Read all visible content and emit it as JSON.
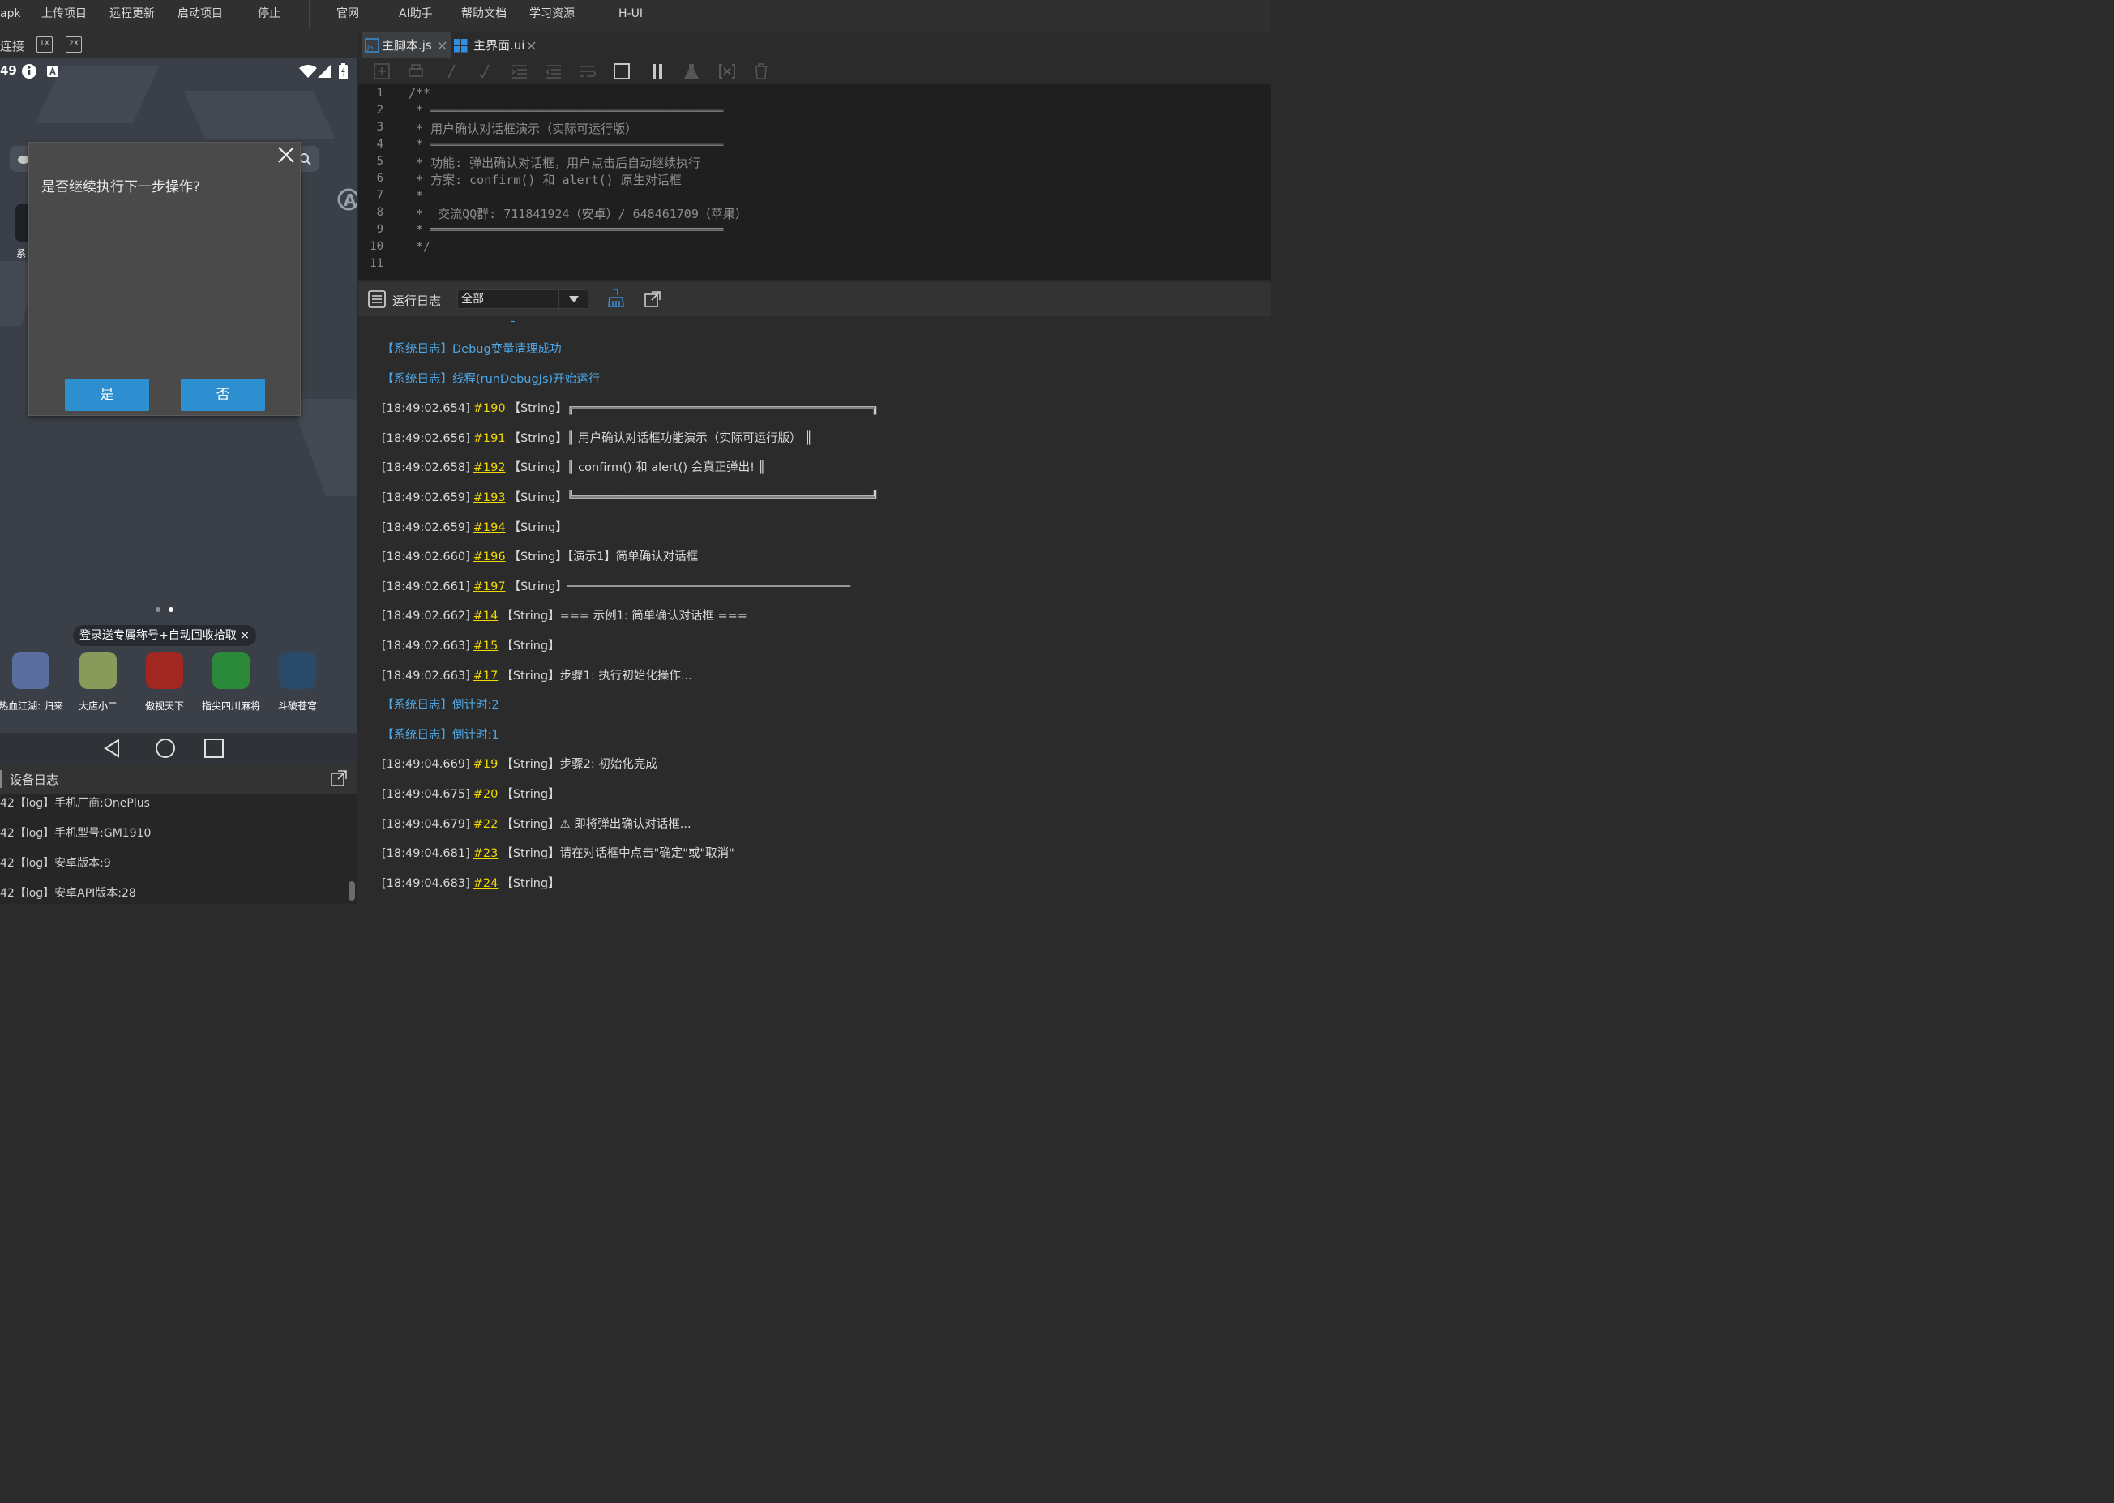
{
  "menu": {
    "items": [
      "apk",
      "上传项目",
      "远程更新",
      "启动项目",
      "停止",
      "官网",
      "AI助手",
      "帮助文档",
      "学习资源",
      "H-UI"
    ]
  },
  "device": {
    "connect_label": "连接",
    "scale_1x": "1X",
    "scale_2x": "2X",
    "status_time": "49",
    "dialog": {
      "message": "是否继续执行下一步操作?",
      "yes_label": "是",
      "no_label": "否"
    },
    "side_app_label": "系",
    "promo_text": "登录送专属称号+自动回收拾取",
    "promo_close": "×",
    "apps": [
      {
        "label": "热血江湖: 归来",
        "color": "#5a6fa0"
      },
      {
        "label": "大店小二",
        "color": "#8a9a5a"
      },
      {
        "label": "傲视天下",
        "color": "#a02820"
      },
      {
        "label": "指尖四川麻将",
        "color": "#2a8a3a"
      },
      {
        "label": "斗破苍穹",
        "color": "#2a4a6a"
      }
    ]
  },
  "device_log": {
    "title": "设备日志",
    "rows": [
      "42【log】手机厂商:OnePlus",
      "42【log】手机型号:GM1910",
      "42【log】安卓版本:9",
      "42【log】安卓API版本:28"
    ]
  },
  "editor": {
    "tabs": [
      {
        "label": "主脚本.js",
        "icon": "js-file-icon"
      },
      {
        "label": "主界面.ui",
        "icon": "ui-file-icon"
      }
    ],
    "line_numbers": [
      "1",
      "2",
      "3",
      "4",
      "5",
      "6",
      "7",
      "8",
      "9",
      "10",
      "11"
    ],
    "code_lines": [
      "/**",
      " * ════════════════════════════════════════",
      " * 用户确认对话框演示（实际可运行版）",
      " * ════════════════════════════════════════",
      " * 功能: 弹出确认对话框，用户点击后自动继续执行",
      " * 方案: confirm() 和 alert() 原生对话框",
      " *",
      " *  交流QQ群: 711841924（安卓）/ 648461709（苹果）",
      " * ════════════════════════════════════════",
      " */",
      ""
    ]
  },
  "run_log": {
    "title": "运行日志",
    "filter_value": "全部",
    "rows": [
      {
        "type": "sys",
        "text": "【系统日志】Debug变量清理成功"
      },
      {
        "type": "sys",
        "text": "【系统日志】线程(runDebugJs)开始运行"
      },
      {
        "type": "log",
        "ts": "[18:49:02.654]",
        "id": "#190",
        "text": "【String】╔══════════════════════════════════════════╗"
      },
      {
        "type": "log",
        "ts": "[18:49:02.656]",
        "id": "#191",
        "text": "【String】║   用户确认对话框功能演示（实际可运行版）    ║"
      },
      {
        "type": "log",
        "ts": "[18:49:02.658]",
        "id": "#192",
        "text": "【String】║   confirm() 和 alert() 会真正弹出!          ║"
      },
      {
        "type": "log",
        "ts": "[18:49:02.659]",
        "id": "#193",
        "text": "【String】╚══════════════════════════════════════════╝"
      },
      {
        "type": "log",
        "ts": "[18:49:02.659]",
        "id": "#194",
        "text": "【String】"
      },
      {
        "type": "log",
        "ts": "[18:49:02.660]",
        "id": "#196",
        "text": "【String】【演示1】简单确认对话框"
      },
      {
        "type": "log",
        "ts": "[18:49:02.661]",
        "id": "#197",
        "text": "【String】────────────────────────────────────────"
      },
      {
        "type": "log",
        "ts": "[18:49:02.662]",
        "id": "#14",
        "text": "【String】=== 示例1: 简单确认对话框 ==="
      },
      {
        "type": "log",
        "ts": "[18:49:02.663]",
        "id": "#15",
        "text": "【String】"
      },
      {
        "type": "log",
        "ts": "[18:49:02.663]",
        "id": "#17",
        "text": "【String】步骤1: 执行初始化操作..."
      },
      {
        "type": "sys",
        "text": "【系统日志】倒计时:2"
      },
      {
        "type": "sys",
        "text": "【系统日志】倒计时:1"
      },
      {
        "type": "log",
        "ts": "[18:49:04.669]",
        "id": "#19",
        "text": "【String】步骤2: 初始化完成"
      },
      {
        "type": "log",
        "ts": "[18:49:04.675]",
        "id": "#20",
        "text": "【String】"
      },
      {
        "type": "log",
        "ts": "[18:49:04.679]",
        "id": "#22",
        "text": "【String】⚠  即将弹出确认对话框..."
      },
      {
        "type": "log",
        "ts": "[18:49:04.681]",
        "id": "#23",
        "text": "【String】请在对话框中点击\"确定\"或\"取消\""
      },
      {
        "type": "log",
        "ts": "[18:49:04.683]",
        "id": "#24",
        "text": "【String】"
      }
    ]
  }
}
